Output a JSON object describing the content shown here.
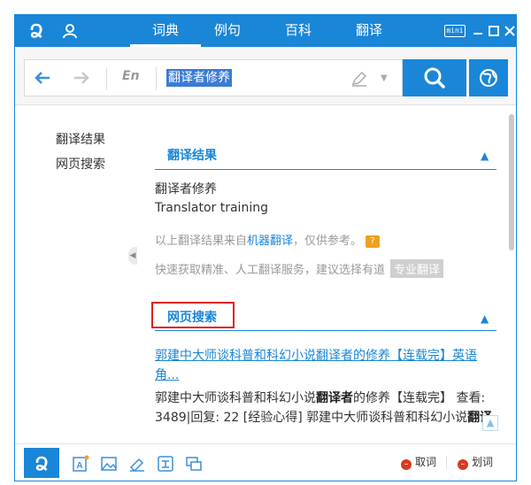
{
  "app": {
    "logo_text": "ღ",
    "tabs": [
      {
        "label": "词典",
        "active": true
      },
      {
        "label": "例句",
        "active": false
      },
      {
        "label": "百科",
        "active": false
      },
      {
        "label": "翻译",
        "active": false
      }
    ],
    "mini_label": "mini",
    "window_controls": [
      "minimize",
      "maximize",
      "close"
    ]
  },
  "search": {
    "lang": "En",
    "query": "翻译者修养"
  },
  "sidebar": {
    "items": [
      {
        "label": "翻译结果"
      },
      {
        "label": "网页搜索"
      }
    ]
  },
  "translation": {
    "section_title": "翻译结果",
    "source": "翻译者修养",
    "result": "Translator training",
    "note_prefix": "以上翻译结果来自",
    "note_link": "机器翻译",
    "note_suffix": "，仅供参考。",
    "help_badge": "?",
    "service_text": "快速获取精准、人工翻译服务，建议选择有道",
    "pro_button": "专业翻译"
  },
  "web_search": {
    "section_title": "网页搜索",
    "result_title": "郭建中大师谈科普和科幻小说翻译者的修养【连载完】英语角...",
    "desc_1": "郭建中大师谈科普和科幻小说",
    "desc_bold_1": "翻译者",
    "desc_2": "的修养【连载完】 查看: 3489|回复: 22 [经验心得] 郭建中大师谈科普和科幻小说",
    "desc_bold_2": "翻译"
  },
  "bottom": {
    "logo_text": "ღ",
    "tools": [
      "ocr-capture-icon",
      "image-translate-icon",
      "word-book-icon",
      "translate-icon",
      "chat-icon"
    ],
    "action_1": "取词",
    "action_2": "划词"
  },
  "colors": {
    "brand": "#1a86d8",
    "highlight_box": "#e02020",
    "off_indicator": "#d63a1e"
  }
}
